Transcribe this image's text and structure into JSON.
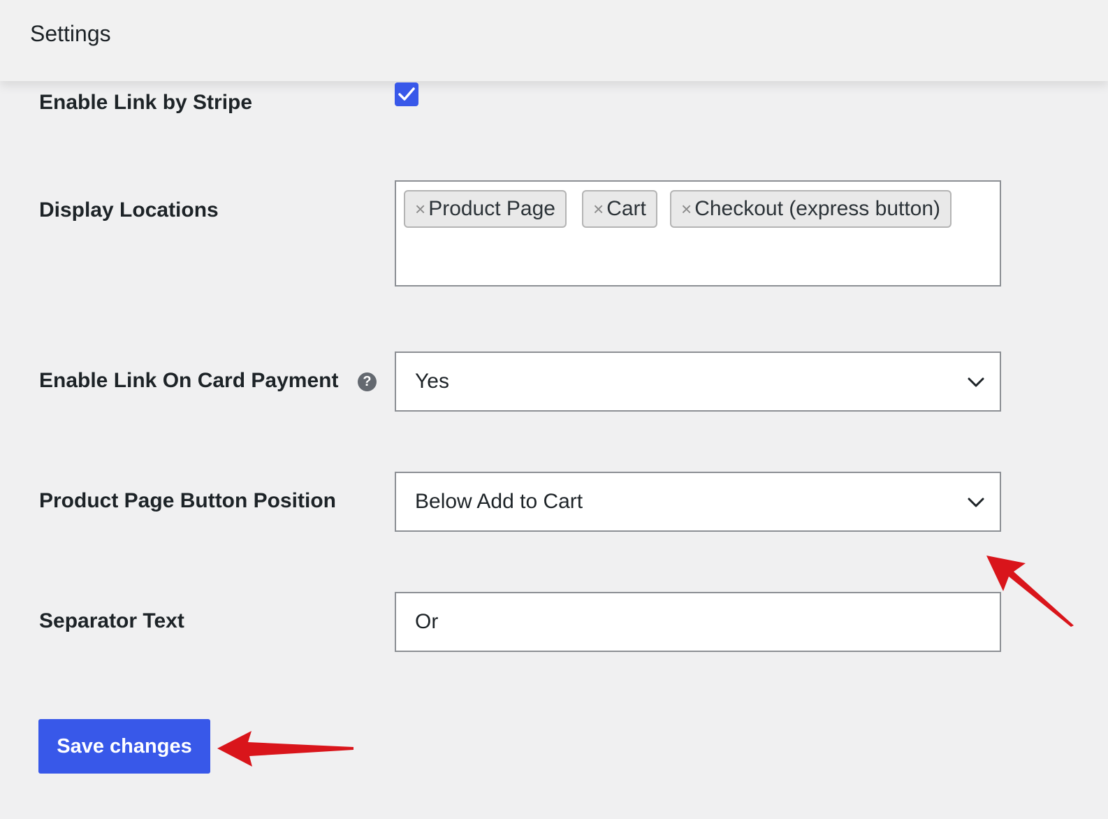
{
  "header": {
    "title": "Settings"
  },
  "fields": {
    "enable_link": {
      "label": "Enable Link by Stripe",
      "checked": true
    },
    "display_locations": {
      "label": "Display Locations",
      "tokens": [
        "Product Page",
        "Cart",
        "Checkout (express button)"
      ],
      "remove_glyph": "×"
    },
    "card_payment": {
      "label": "Enable Link On Card Payment",
      "help_glyph": "?",
      "value": "Yes"
    },
    "button_position": {
      "label": "Product Page Button Position",
      "value": "Below Add to Cart"
    },
    "separator": {
      "label": "Separator Text",
      "value": "Or"
    }
  },
  "actions": {
    "save_label": "Save changes"
  },
  "colors": {
    "accent": "#3858e9",
    "annotation_arrow": "#d9151b",
    "background": "#f0f0f1"
  },
  "icons": {
    "checkbox": "checkmark-icon",
    "help": "question-circle-icon",
    "dropdown": "chevron-down-icon",
    "annotation": "red-arrow-icon"
  }
}
